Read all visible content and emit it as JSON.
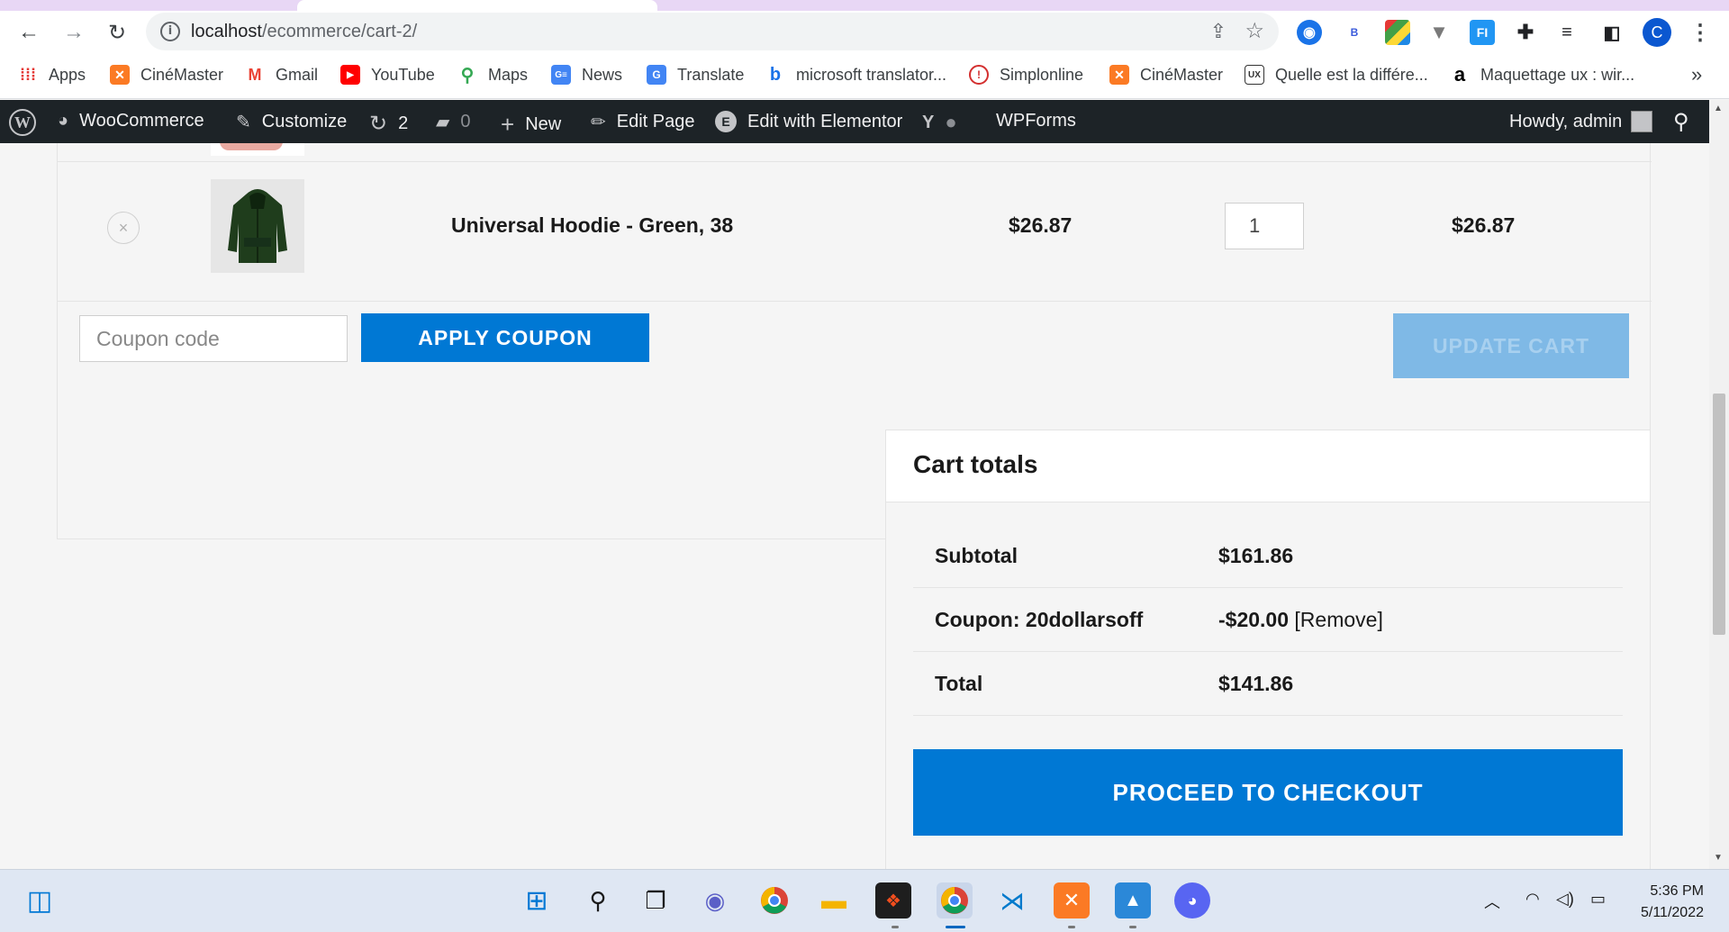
{
  "browser": {
    "url_host": "localhost",
    "url_path": "/ecommerce/cart-2/",
    "profile_initial": "C",
    "extensions": [
      "B",
      "FI"
    ]
  },
  "bookmarks": [
    {
      "label": "Apps",
      "icon": "apps-grid-icon"
    },
    {
      "label": "CinéMaster",
      "icon": "xampp-icon"
    },
    {
      "label": "Gmail",
      "icon": "gmail-icon"
    },
    {
      "label": "YouTube",
      "icon": "youtube-icon"
    },
    {
      "label": "Maps",
      "icon": "maps-icon"
    },
    {
      "label": "News",
      "icon": "news-icon"
    },
    {
      "label": "Translate",
      "icon": "translate-icon"
    },
    {
      "label": "microsoft translator...",
      "icon": "bing-icon"
    },
    {
      "label": "Simplonline",
      "icon": "simplonline-icon"
    },
    {
      "label": "CinéMaster",
      "icon": "xampp-icon"
    },
    {
      "label": "Quelle est la différe...",
      "icon": "blog-ux-icon"
    },
    {
      "label": "Maquettage ux : wir...",
      "icon": "amazon-icon"
    }
  ],
  "adminbar": {
    "woocommerce": "WooCommerce",
    "customize": "Customize",
    "updates_count": "2",
    "comments_count": "0",
    "new": "New",
    "edit_page": "Edit Page",
    "elementor": "Edit with Elementor",
    "wpforms": "WPForms",
    "howdy": "Howdy, admin"
  },
  "cart": {
    "item": {
      "name": "Universal Hoodie - Green, 38",
      "price": "$26.87",
      "quantity": "1",
      "subtotal": "$26.87"
    },
    "coupon_placeholder": "Coupon code",
    "apply_label": "APPLY COUPON",
    "update_label": "UPDATE CART"
  },
  "totals": {
    "title": "Cart totals",
    "rows": [
      {
        "label": "Subtotal",
        "value": "$161.86"
      },
      {
        "label": "Coupon: 20dollarsoff",
        "value": "-$20.00",
        "extra": "[Remove]"
      },
      {
        "label": "Total",
        "value": "$141.86"
      }
    ],
    "checkout_label": "PROCEED TO CHECKOUT"
  },
  "taskbar": {
    "time": "5:36 PM",
    "date": "5/11/2022"
  },
  "colors": {
    "accent": "#0078d4",
    "accent_disabled": "#7fb9e6",
    "adminbar": "#1d2327"
  }
}
